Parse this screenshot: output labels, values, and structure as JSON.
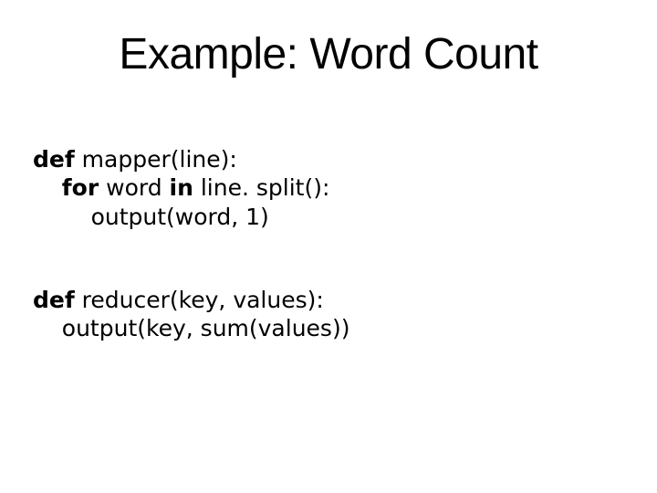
{
  "title": "Example: Word Count",
  "code": {
    "mapper": {
      "def_kw": "def",
      "sig": " mapper(line):",
      "for_indent": "    ",
      "for_kw": "for",
      "for_mid": " word ",
      "in_kw": "in",
      "for_tail": " line. split():",
      "body_indent": "        ",
      "body": "output(word, 1)"
    },
    "reducer": {
      "def_kw": "def",
      "sig": " reducer(key, values):",
      "body_indent": "    ",
      "body": "output(key, sum(values))"
    }
  }
}
